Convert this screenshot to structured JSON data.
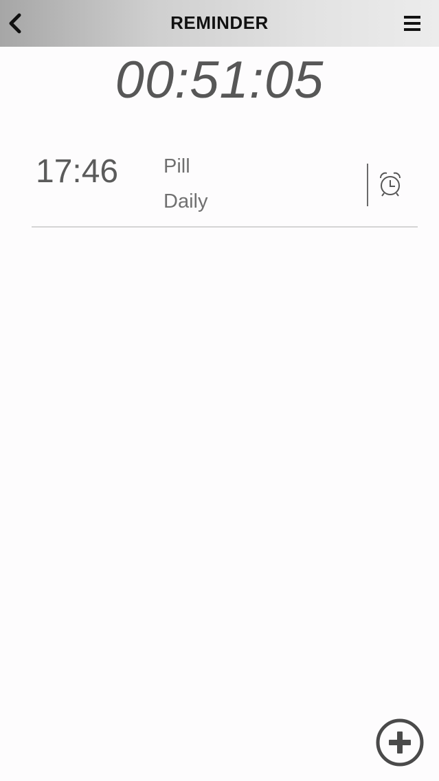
{
  "header": {
    "title": "REMINDER",
    "back_icon": "chevron-left-icon",
    "menu_icon": "hamburger-menu-icon",
    "background_colors": [
      "#a6a6a6",
      "#ececec"
    ]
  },
  "countdown": {
    "value": "00:51:05",
    "color": "#575757"
  },
  "reminders": [
    {
      "time": "17:46",
      "name": "Pill",
      "repeat": "Daily",
      "icon": "alarm-clock-icon"
    }
  ],
  "fab": {
    "icon": "plus-circle-icon"
  }
}
